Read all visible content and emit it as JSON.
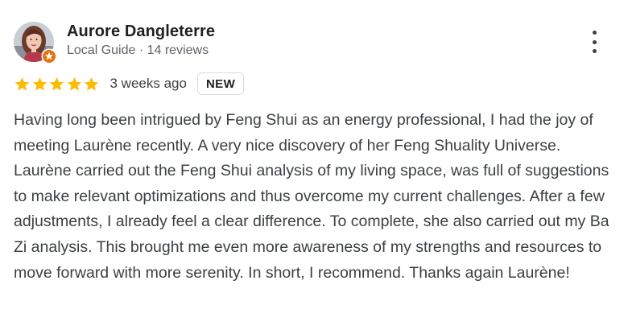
{
  "review": {
    "reviewer": {
      "name": "Aurore Dangleterre",
      "meta": "Local Guide · 14 reviews",
      "avatar_icon": "avatar-photo",
      "badge_icon": "local-guide-star-icon"
    },
    "rating": {
      "stars": 5,
      "max_stars": 5,
      "star_color": "#fbbc04"
    },
    "time_ago": "3 weeks ago",
    "badge": "NEW",
    "text": "Having long been intrigued by Feng Shui as an energy professional, I had the joy of meeting Laurène recently. A very nice discovery of her Feng Shuality Universe. Laurène carried out the Feng Shui analysis of my living space, was full of suggestions to make relevant optimizations and thus overcome my current challenges. After a few adjustments, I already feel a clear difference. To complete, she also carried out my Ba Zi analysis. This brought me even more awareness of my strengths and resources to move forward with more serenity. In short, I recommend. Thanks again Laurène!",
    "menu_icon": "more-vert-icon"
  },
  "colors": {
    "name": "#202124",
    "meta": "#5f6368",
    "body": "#3c4043",
    "guide_badge": "#e8710a"
  }
}
